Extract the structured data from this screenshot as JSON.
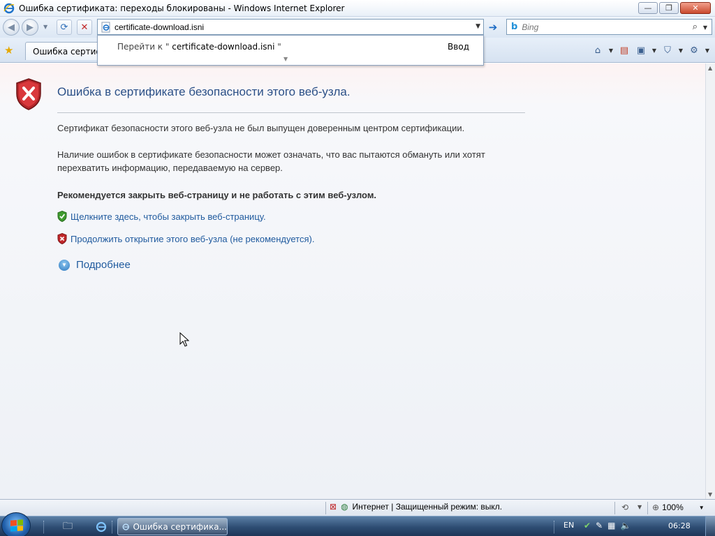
{
  "window": {
    "title": "Ошибка сертификата: переходы блокированы - Windows Internet Explorer",
    "minimize": "—",
    "maximize": "❐",
    "close": "✕"
  },
  "nav": {
    "address_value": "certificate-download.isni",
    "search_placeholder": "Bing",
    "refresh_glyph": "⟳",
    "stop_glyph": "✕",
    "go_glyph": "➔"
  },
  "autocomplete": {
    "goto_prefix": "Перейти к \"",
    "goto_url": "certificate-download.isni",
    "goto_suffix": "\"",
    "enter_label": "Ввод"
  },
  "tab": {
    "label": "Ошибка сертификата: переходы блокированы"
  },
  "content": {
    "title": "Ошибка в сертификате безопасности этого веб-узла.",
    "para1": "Сертификат безопасности этого веб-узла не был выпущен доверенным центром сертификации.",
    "para2": "Наличие ошибок в сертификате безопасности может означать, что вас пытаются обмануть или хотят перехватить информацию, передаваемую на сервер.",
    "recommend": "Рекомендуется закрыть веб-страницу и не работать с этим веб-узлом.",
    "close_link": "Щелкните здесь, чтобы закрыть веб-страницу.",
    "continue_link": "Продолжить открытие этого веб-узла (не рекомендуется).",
    "more_info": "Подробнее"
  },
  "status": {
    "zone_text": "Интернет | Защищенный режим: выкл.",
    "zoom": "100%"
  },
  "taskbar": {
    "task_label": "Ошибка сертифика...",
    "lang": "EN",
    "clock": "06:28"
  },
  "colors": {
    "accent_link": "#1f5a9e",
    "title_blue": "#2a4f87",
    "error_red": "#c0282a",
    "ok_green": "#3f9b2f"
  },
  "icons": {
    "title": "ie-logo-icon",
    "shield": "error-shield-icon",
    "close_page": "green-shield-icon",
    "continue": "red-shield-icon",
    "more": "expand-circle-icon"
  }
}
